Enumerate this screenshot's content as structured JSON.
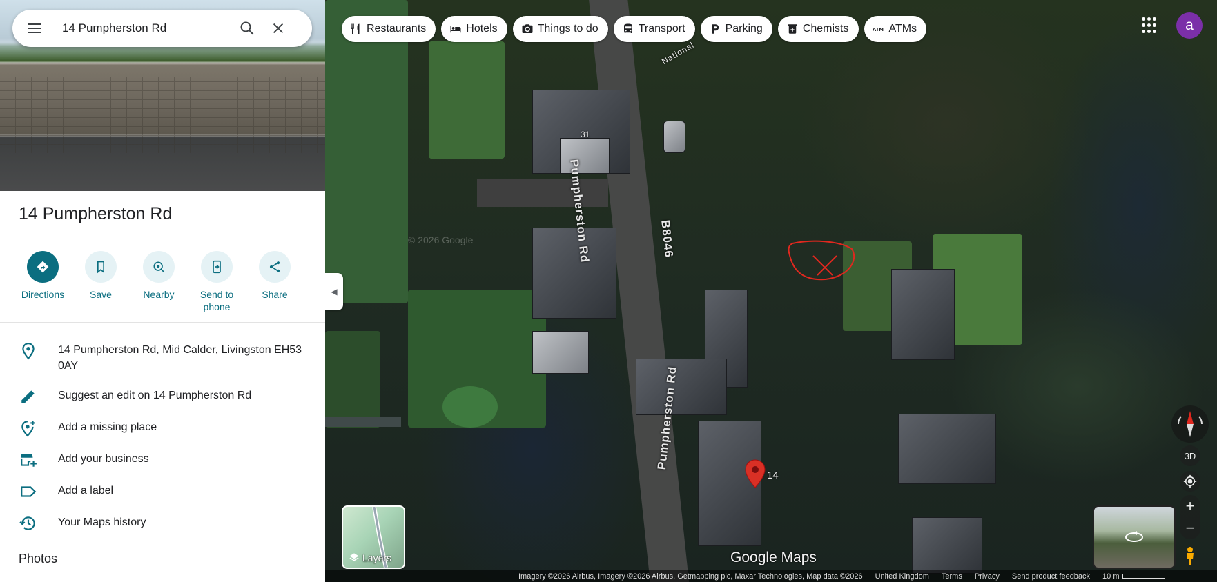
{
  "search": {
    "value": "14 Pumpherston Rd",
    "menu_icon": "menu-icon",
    "search_icon": "search-icon",
    "clear_icon": "close-icon"
  },
  "place": {
    "title": "14 Pumpherston Rd"
  },
  "actions": [
    {
      "label": "Directions",
      "icon": "directions-icon"
    },
    {
      "label": "Save",
      "icon": "bookmark-icon"
    },
    {
      "label": "Nearby",
      "icon": "nearby-icon"
    },
    {
      "label": "Send to phone",
      "icon": "send-to-phone-icon"
    },
    {
      "label": "Share",
      "icon": "share-icon"
    }
  ],
  "info_rows": [
    {
      "text": "14 Pumpherston Rd, Mid Calder, Livingston EH53 0AY",
      "icon": "location-pin-icon"
    },
    {
      "text": "Suggest an edit on 14 Pumpherston Rd",
      "icon": "pencil-icon"
    },
    {
      "text": "Add a missing place",
      "icon": "add-place-icon"
    },
    {
      "text": "Add your business",
      "icon": "add-business-icon"
    },
    {
      "text": "Add a label",
      "icon": "label-icon"
    },
    {
      "text": "Your Maps history",
      "icon": "history-icon"
    }
  ],
  "photos_heading": "Photos",
  "chips": [
    {
      "label": "Restaurants",
      "icon": "restaurant-icon"
    },
    {
      "label": "Hotels",
      "icon": "hotel-icon"
    },
    {
      "label": "Things to do",
      "icon": "camera-icon"
    },
    {
      "label": "Transport",
      "icon": "transit-icon"
    },
    {
      "label": "Parking",
      "icon": "parking-icon"
    },
    {
      "label": "Chemists",
      "icon": "pharmacy-icon"
    },
    {
      "label": "ATMs",
      "icon": "atm-icon"
    }
  ],
  "account": {
    "avatar_letter": "a",
    "avatar_color": "#7b2fa8"
  },
  "map": {
    "road_name": "Pumpherston Rd",
    "road_number": "B8046",
    "road_label_top_partial": "National",
    "house_numbers": [
      "31",
      "14"
    ],
    "pin_label": "14",
    "pin_color": "#d93025",
    "annotation_color": "#e0281f",
    "layers_label": "Layers",
    "controls": {
      "three_d": "3D",
      "zoom_in": "+",
      "zoom_out": "−"
    },
    "brand": "Google Maps",
    "watermark": "© 2026 Google"
  },
  "footer": {
    "attribution": "Imagery ©2026 Airbus, Imagery ©2026 Airbus, Getmapping plc, Maxar Technologies, Map data ©2026",
    "country": "United Kingdom",
    "terms": "Terms",
    "privacy": "Privacy",
    "feedback": "Send product feedback",
    "scale": "10 m"
  }
}
